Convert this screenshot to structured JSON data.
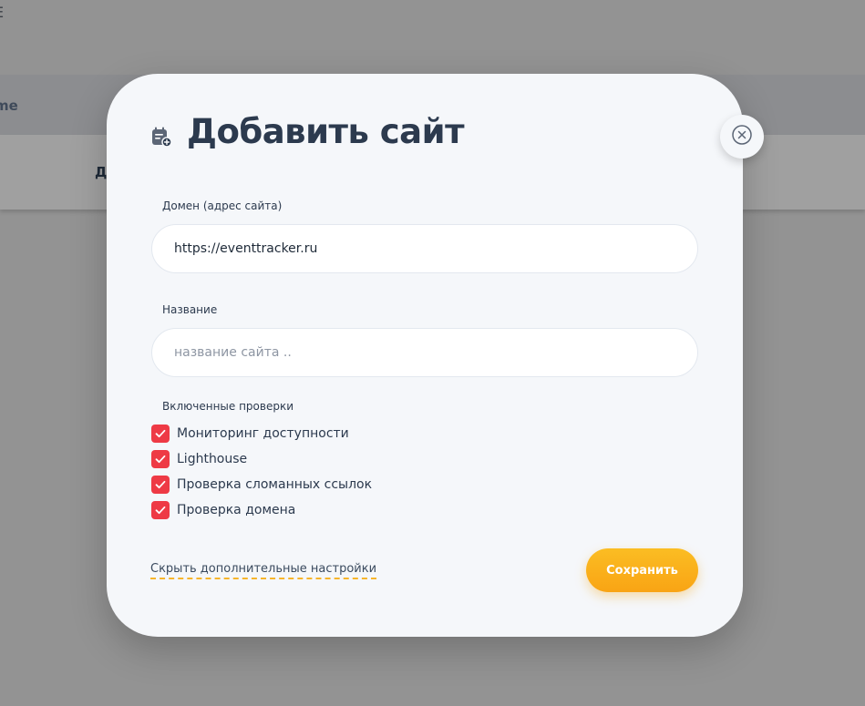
{
  "background": {
    "top_fragment": "Е",
    "band_label": "me",
    "card_label": "Д"
  },
  "modal": {
    "title": "Добавить сайт",
    "title_icon": "calendar-add-icon",
    "close_icon": "close-circle-icon",
    "domain_field": {
      "label": "Домен (адрес сайта)",
      "value": "https://eventtracker.ru",
      "placeholder": ""
    },
    "name_field": {
      "label": "Название",
      "value": "",
      "placeholder": "название сайта .."
    },
    "checks": {
      "label": "Включенные проверки",
      "items": [
        {
          "label": "Мониторинг доступности",
          "checked": true
        },
        {
          "label": "Lighthouse",
          "checked": true
        },
        {
          "label": "Проверка сломанных ссылок",
          "checked": true
        },
        {
          "label": "Проверка домена",
          "checked": true
        }
      ]
    },
    "toggle_link": "Скрыть дополнительные настройки",
    "save_button": "Сохранить"
  },
  "colors": {
    "accent": "#ee3a45",
    "button": "#f9a414",
    "text": "#2c3a4e"
  }
}
